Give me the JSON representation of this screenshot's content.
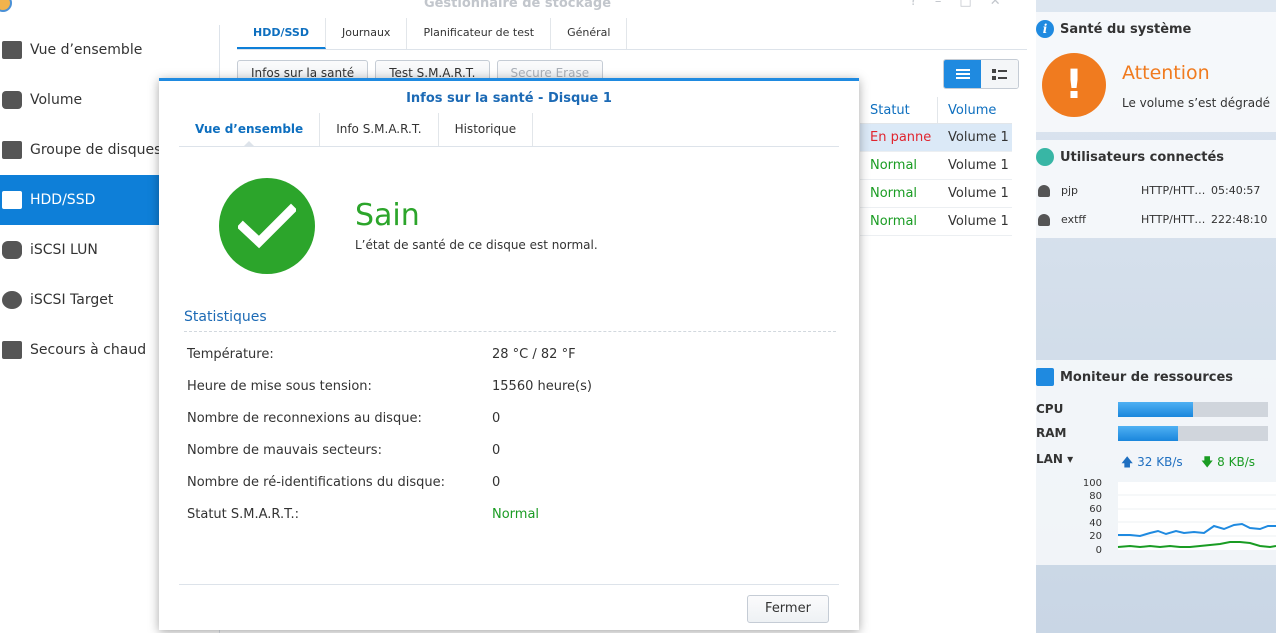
{
  "window": {
    "title": "Gestionnaire de stockage"
  },
  "sidebar": {
    "items": [
      {
        "label": "Vue d’ensemble",
        "icon": "overview-icon"
      },
      {
        "label": "Volume",
        "icon": "volume-icon"
      },
      {
        "label": "Groupe de disques",
        "icon": "disk-group-icon"
      },
      {
        "label": "HDD/SSD",
        "icon": "hdd-icon",
        "active": true
      },
      {
        "label": "iSCSI LUN",
        "icon": "iscsi-lun-icon"
      },
      {
        "label": "iSCSI Target",
        "icon": "globe-icon"
      },
      {
        "label": "Secours à chaud",
        "icon": "hot-spare-icon"
      }
    ]
  },
  "main": {
    "tabs": [
      "HDD/SSD",
      "Journaux",
      "Planificateur de test",
      "Général"
    ],
    "buttons": {
      "health": "Infos sur la santé",
      "smart": "Test S.M.A.R.T.",
      "erase": "Secure Erase"
    },
    "table": {
      "headers": [
        "Statut",
        "Volume"
      ],
      "rows": [
        {
          "status": "En panne",
          "volume": "Volume 1"
        },
        {
          "status": "Normal",
          "volume": "Volume 1"
        },
        {
          "status": "Normal",
          "volume": "Volume 1"
        },
        {
          "status": "Normal",
          "volume": "Volume 1"
        }
      ]
    }
  },
  "dialog": {
    "title": "Infos sur la santé - Disque 1",
    "tabs": [
      "Vue d’ensemble",
      "Info S.M.A.R.T.",
      "Historique"
    ],
    "status": "Sain",
    "status_desc": "L’état de santé de ce disque est normal.",
    "stats_title": "Statistiques",
    "stats": [
      {
        "label": "Température:",
        "value": "28 °C / 82 °F"
      },
      {
        "label": "Heure de mise sous tension:",
        "value": "15560 heure(s)"
      },
      {
        "label": "Nombre de reconnexions au disque:",
        "value": "0"
      },
      {
        "label": "Nombre de mauvais secteurs:",
        "value": "0"
      },
      {
        "label": "Nombre de ré-identifications du disque:",
        "value": "0"
      },
      {
        "label": "Statut S.M.A.R.T.:",
        "value": "Normal"
      }
    ],
    "close_label": "Fermer"
  },
  "widgets": {
    "health": {
      "title": "Santé du système",
      "status": "Attention",
      "desc": "Le volume s’est dégradé"
    },
    "users": {
      "title": "Utilisateurs connectés",
      "rows": [
        {
          "name": "pjp",
          "protocol": "HTTP/HTT…",
          "time": "05:40:57"
        },
        {
          "name": "extff",
          "protocol": "HTTP/HTT…",
          "time": "222:48:10"
        }
      ]
    },
    "monitor": {
      "title": "Moniteur de ressources",
      "cpu_label": "CPU",
      "ram_label": "RAM",
      "lan_label": "LAN ▾",
      "cpu_usage": 0.5,
      "ram_usage": 0.4,
      "lan_up": "32 KB/s",
      "lan_down": "8 KB/s",
      "y_ticks": [
        "100",
        "80",
        "60",
        "40",
        "20",
        "0"
      ]
    }
  },
  "colors": {
    "accent": "#0e7fd8",
    "ok": "#2ca52b",
    "fail": "#e0252f",
    "warn": "#f07b1f"
  }
}
